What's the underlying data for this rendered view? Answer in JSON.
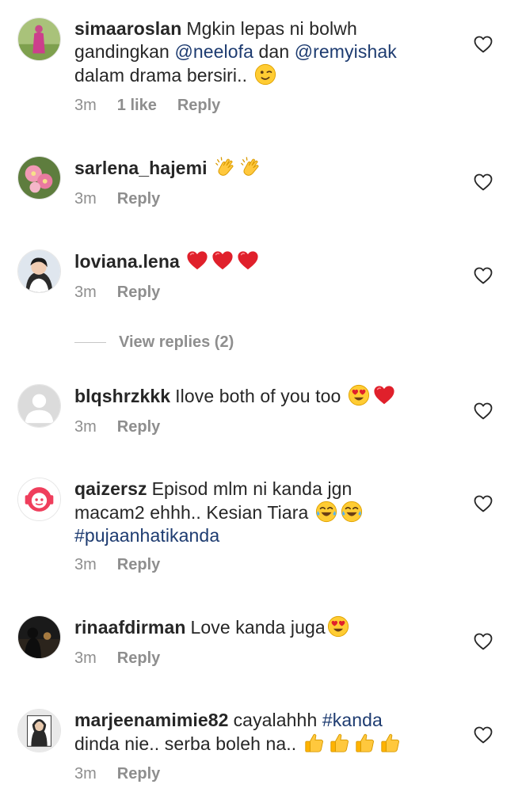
{
  "comments": [
    {
      "username": "simaaroslan",
      "text_parts": [
        "Mgkin lepas ni bolwh ",
        "gandingkan ",
        "@neelofa",
        " dan ",
        "@remyishak",
        "dalam drama bersiri.."
      ],
      "emojis": [
        "wink-emoji"
      ],
      "time": "3m",
      "likes": "1 like",
      "reply": "Reply"
    },
    {
      "username": "sarlena_hajemi",
      "emojis": [
        "clapping-emoji",
        "clapping-emoji"
      ],
      "time": "3m",
      "reply": "Reply"
    },
    {
      "username": "loviana.lena",
      "emojis": [
        "red-heart-emoji",
        "red-heart-emoji",
        "red-heart-emoji"
      ],
      "time": "3m",
      "reply": "Reply",
      "view_replies": "View replies (2)"
    },
    {
      "username": "blqshrzkkk",
      "text": "Ilove both of you too",
      "emojis": [
        "heart-eyes-emoji",
        "red-heart-emoji"
      ],
      "time": "3m",
      "reply": "Reply"
    },
    {
      "username": "qaizersz",
      "text_line1": "Episod mlm ni kanda jgn",
      "text_line2": "macam2 ehhh.. Kesian Tiara",
      "hashtag": "#pujaanhatikanda",
      "emojis": [
        "tears-of-joy-emoji",
        "tears-of-joy-emoji"
      ],
      "time": "3m",
      "reply": "Reply"
    },
    {
      "username": "rinaafdirman",
      "text": "Love kanda juga",
      "emojis": [
        "heart-eyes-emoji"
      ],
      "time": "3m",
      "reply": "Reply"
    },
    {
      "username": "marjeenamimie82",
      "text_before": "cayalahhh ",
      "hashtag": "#kanda",
      "text_line2": "dinda nie.. serba boleh na..",
      "emojis": [
        "thumbs-up-emoji",
        "thumbs-up-emoji",
        "thumbs-up-emoji",
        "thumbs-up-emoji"
      ],
      "time": "3m",
      "reply": "Reply"
    }
  ],
  "colors": {
    "text": "#262626",
    "meta": "#8e8e8e",
    "mention": "#1d3b70"
  }
}
